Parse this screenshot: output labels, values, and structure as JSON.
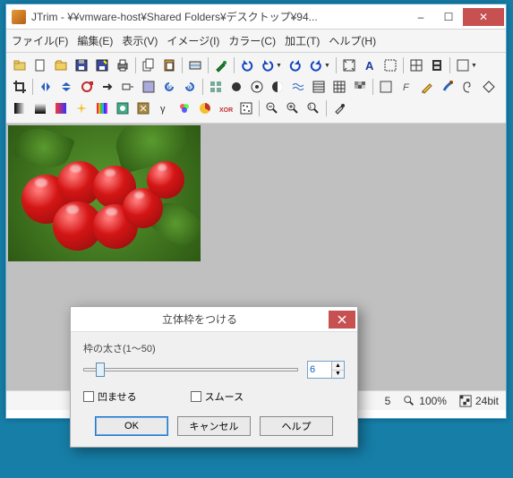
{
  "window": {
    "title": "JTrim - ¥¥vmware-host¥Shared Folders¥デスクトップ¥94...",
    "controls": {
      "minimize": "–",
      "maximize": "☐",
      "close": "✕"
    }
  },
  "menu": {
    "file": "ファイル(F)",
    "edit": "編集(E)",
    "view": "表示(V)",
    "image": "イメージ(I)",
    "color": "カラー(C)",
    "process": "加工(T)",
    "help": "ヘルプ(H)"
  },
  "toolbar": {
    "r1": [
      "open-file",
      "new",
      "open",
      "save",
      "save-as",
      "print",
      "sep",
      "copy",
      "paste",
      "sep",
      "scan",
      "sep",
      "paint",
      "sep",
      "undo",
      "undo-dd",
      "redo",
      "redo-dd",
      "sep",
      "fit",
      "font",
      "select-sw",
      "sep",
      "grid",
      "film",
      "sep",
      "settings-dd"
    ],
    "r2": [
      "crop",
      "sep",
      "flip-h",
      "flip-v",
      "rot-arb",
      "move-r",
      "move-rect",
      "square",
      "rot-ccw",
      "rot-cw",
      "sep",
      "tile",
      "circle",
      "vignette",
      "contrast",
      "waves",
      "stripes",
      "grid-3",
      "mosaic",
      "sep",
      "sharpen",
      "filter-f",
      "pencil",
      "brush",
      "spiral",
      "diamond"
    ],
    "r3": [
      "grad1",
      "grad2",
      "grad3",
      "sparkle",
      "rainbow",
      "fx1",
      "fx2",
      "gamma",
      "rgb",
      "pie",
      "xor",
      "dither",
      "sep",
      "zoom-out",
      "zoom-in",
      "zoom-reset",
      "sep",
      "eyedrop"
    ]
  },
  "status": {
    "size": "5",
    "zoom": "100%",
    "depth": "24bit"
  },
  "dialog": {
    "title": "立体枠をつける",
    "thickness_label": "枠の太さ(1～50)",
    "thickness_value": "6",
    "indent_label": "凹ませる",
    "smooth_label": "スムース",
    "ok": "OK",
    "cancel": "キャンセル",
    "help": "ヘルプ"
  }
}
